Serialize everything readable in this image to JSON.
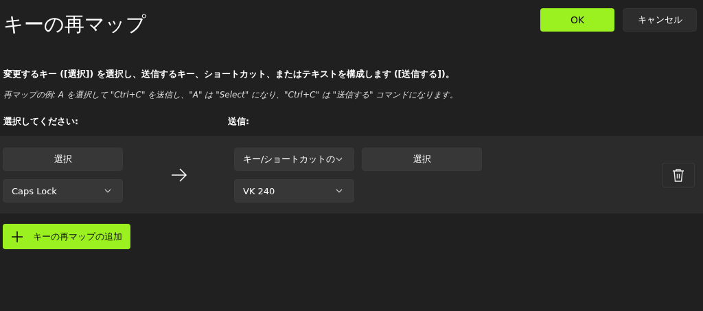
{
  "header": {
    "title": "キーの再マップ",
    "ok_button": "OK",
    "cancel_button": "キャンセル"
  },
  "description": "変更するキー ([選択]) を選択し、送信するキー、ショートカット、またはテキストを構成します ([送信する])。",
  "example": "再マップの例: A を選択して \"Ctrl+C\" を送信し、\"A\" は \"Select\" になり、\"Ctrl+C\" は \"送信する\" コマンドになります。",
  "columns": {
    "select_label": "選択してください:",
    "send_label": "送信:"
  },
  "mappings": [
    {
      "select_button": "選択",
      "original_key": "Caps Lock",
      "send_type": "キー/ショートカットの",
      "send_select_button": "選択",
      "send_key": "VK 240"
    }
  ],
  "add_button": "キーの再マップの追加"
}
